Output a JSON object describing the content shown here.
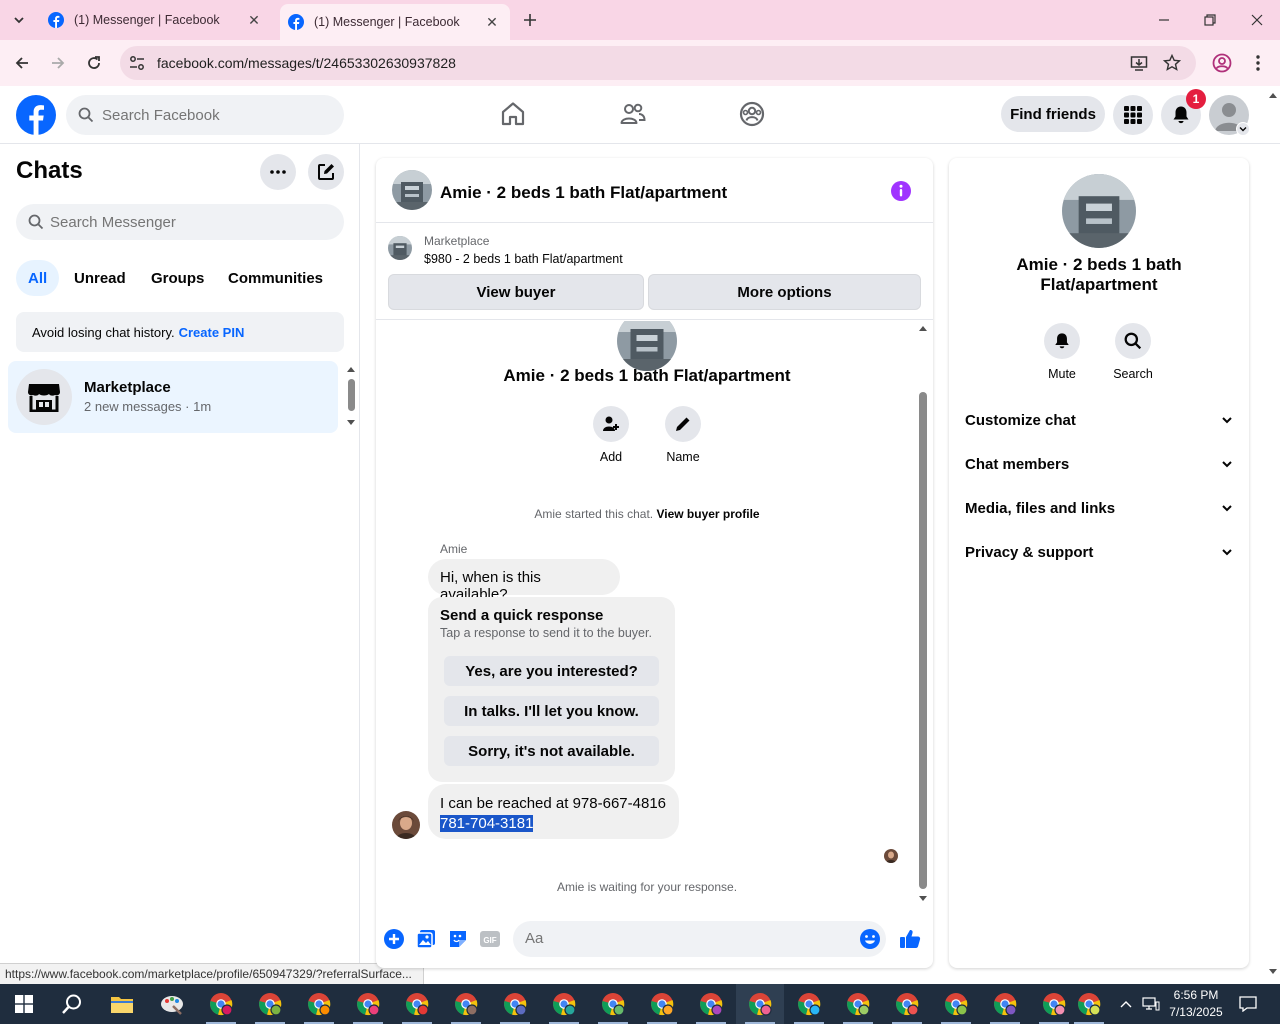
{
  "browser": {
    "tabs": [
      {
        "title": "(1) Messenger | Facebook",
        "active": false
      },
      {
        "title": "(1) Messenger | Facebook",
        "active": true
      }
    ],
    "url": "facebook.com/messages/t/24653302630937828",
    "status_url": "https://www.facebook.com/marketplace/profile/650947329/?referralSurface..."
  },
  "fb_header": {
    "search_placeholder": "Search Facebook",
    "find_friends": "Find friends",
    "notification_count": "1"
  },
  "chats": {
    "title": "Chats",
    "search_placeholder": "Search Messenger",
    "filters": [
      "All",
      "Unread",
      "Groups",
      "Communities"
    ],
    "active_filter": "All",
    "pin_banner": {
      "text": "Avoid losing chat history.",
      "link": "Create PIN"
    },
    "items": [
      {
        "name": "Marketplace",
        "preview": "2 new messages · 1m"
      }
    ]
  },
  "conversation": {
    "title": "Amie · 2 beds 1 bath Flat/apartment",
    "marketplace": {
      "label": "Marketplace",
      "listing": "$980 - 2 beds 1 bath Flat/apartment",
      "view_buyer": "View buyer",
      "more_options": "More options"
    },
    "intro": {
      "name": "Amie · 2 beds 1 bath Flat/apartment",
      "actions": [
        "Add",
        "Name"
      ]
    },
    "started_text": "Amie started this chat.",
    "started_link": "View buyer profile",
    "sender_name": "Amie",
    "messages": [
      {
        "text": "Hi, when is this available?"
      }
    ],
    "quick_response": {
      "title": "Send a quick response",
      "subtitle": "Tap a response to send it to the buyer.",
      "options": [
        "Yes, are you interested?",
        "In talks. I'll let you know.",
        "Sorry, it's not available."
      ]
    },
    "last_message": {
      "line1": "I can be reached at 978-667-4816",
      "line2_selected": "781-704-3181"
    },
    "waiting_text": "Amie is waiting for your response.",
    "compose_placeholder": "Aa"
  },
  "right_panel": {
    "name": "Amie · 2 beds 1 bath Flat/apartment",
    "actions": [
      "Mute",
      "Search"
    ],
    "sections": [
      "Customize chat",
      "Chat members",
      "Media, files and links",
      "Privacy & support"
    ]
  },
  "taskbar": {
    "time": "6:56 PM",
    "date": "7/13/2025"
  },
  "colors": {
    "fb_blue": "#0866ff",
    "messenger_purple": "#a033ff",
    "tab_strip_pink": "#f9d6e6",
    "taskbar": "#1f2d3e"
  }
}
